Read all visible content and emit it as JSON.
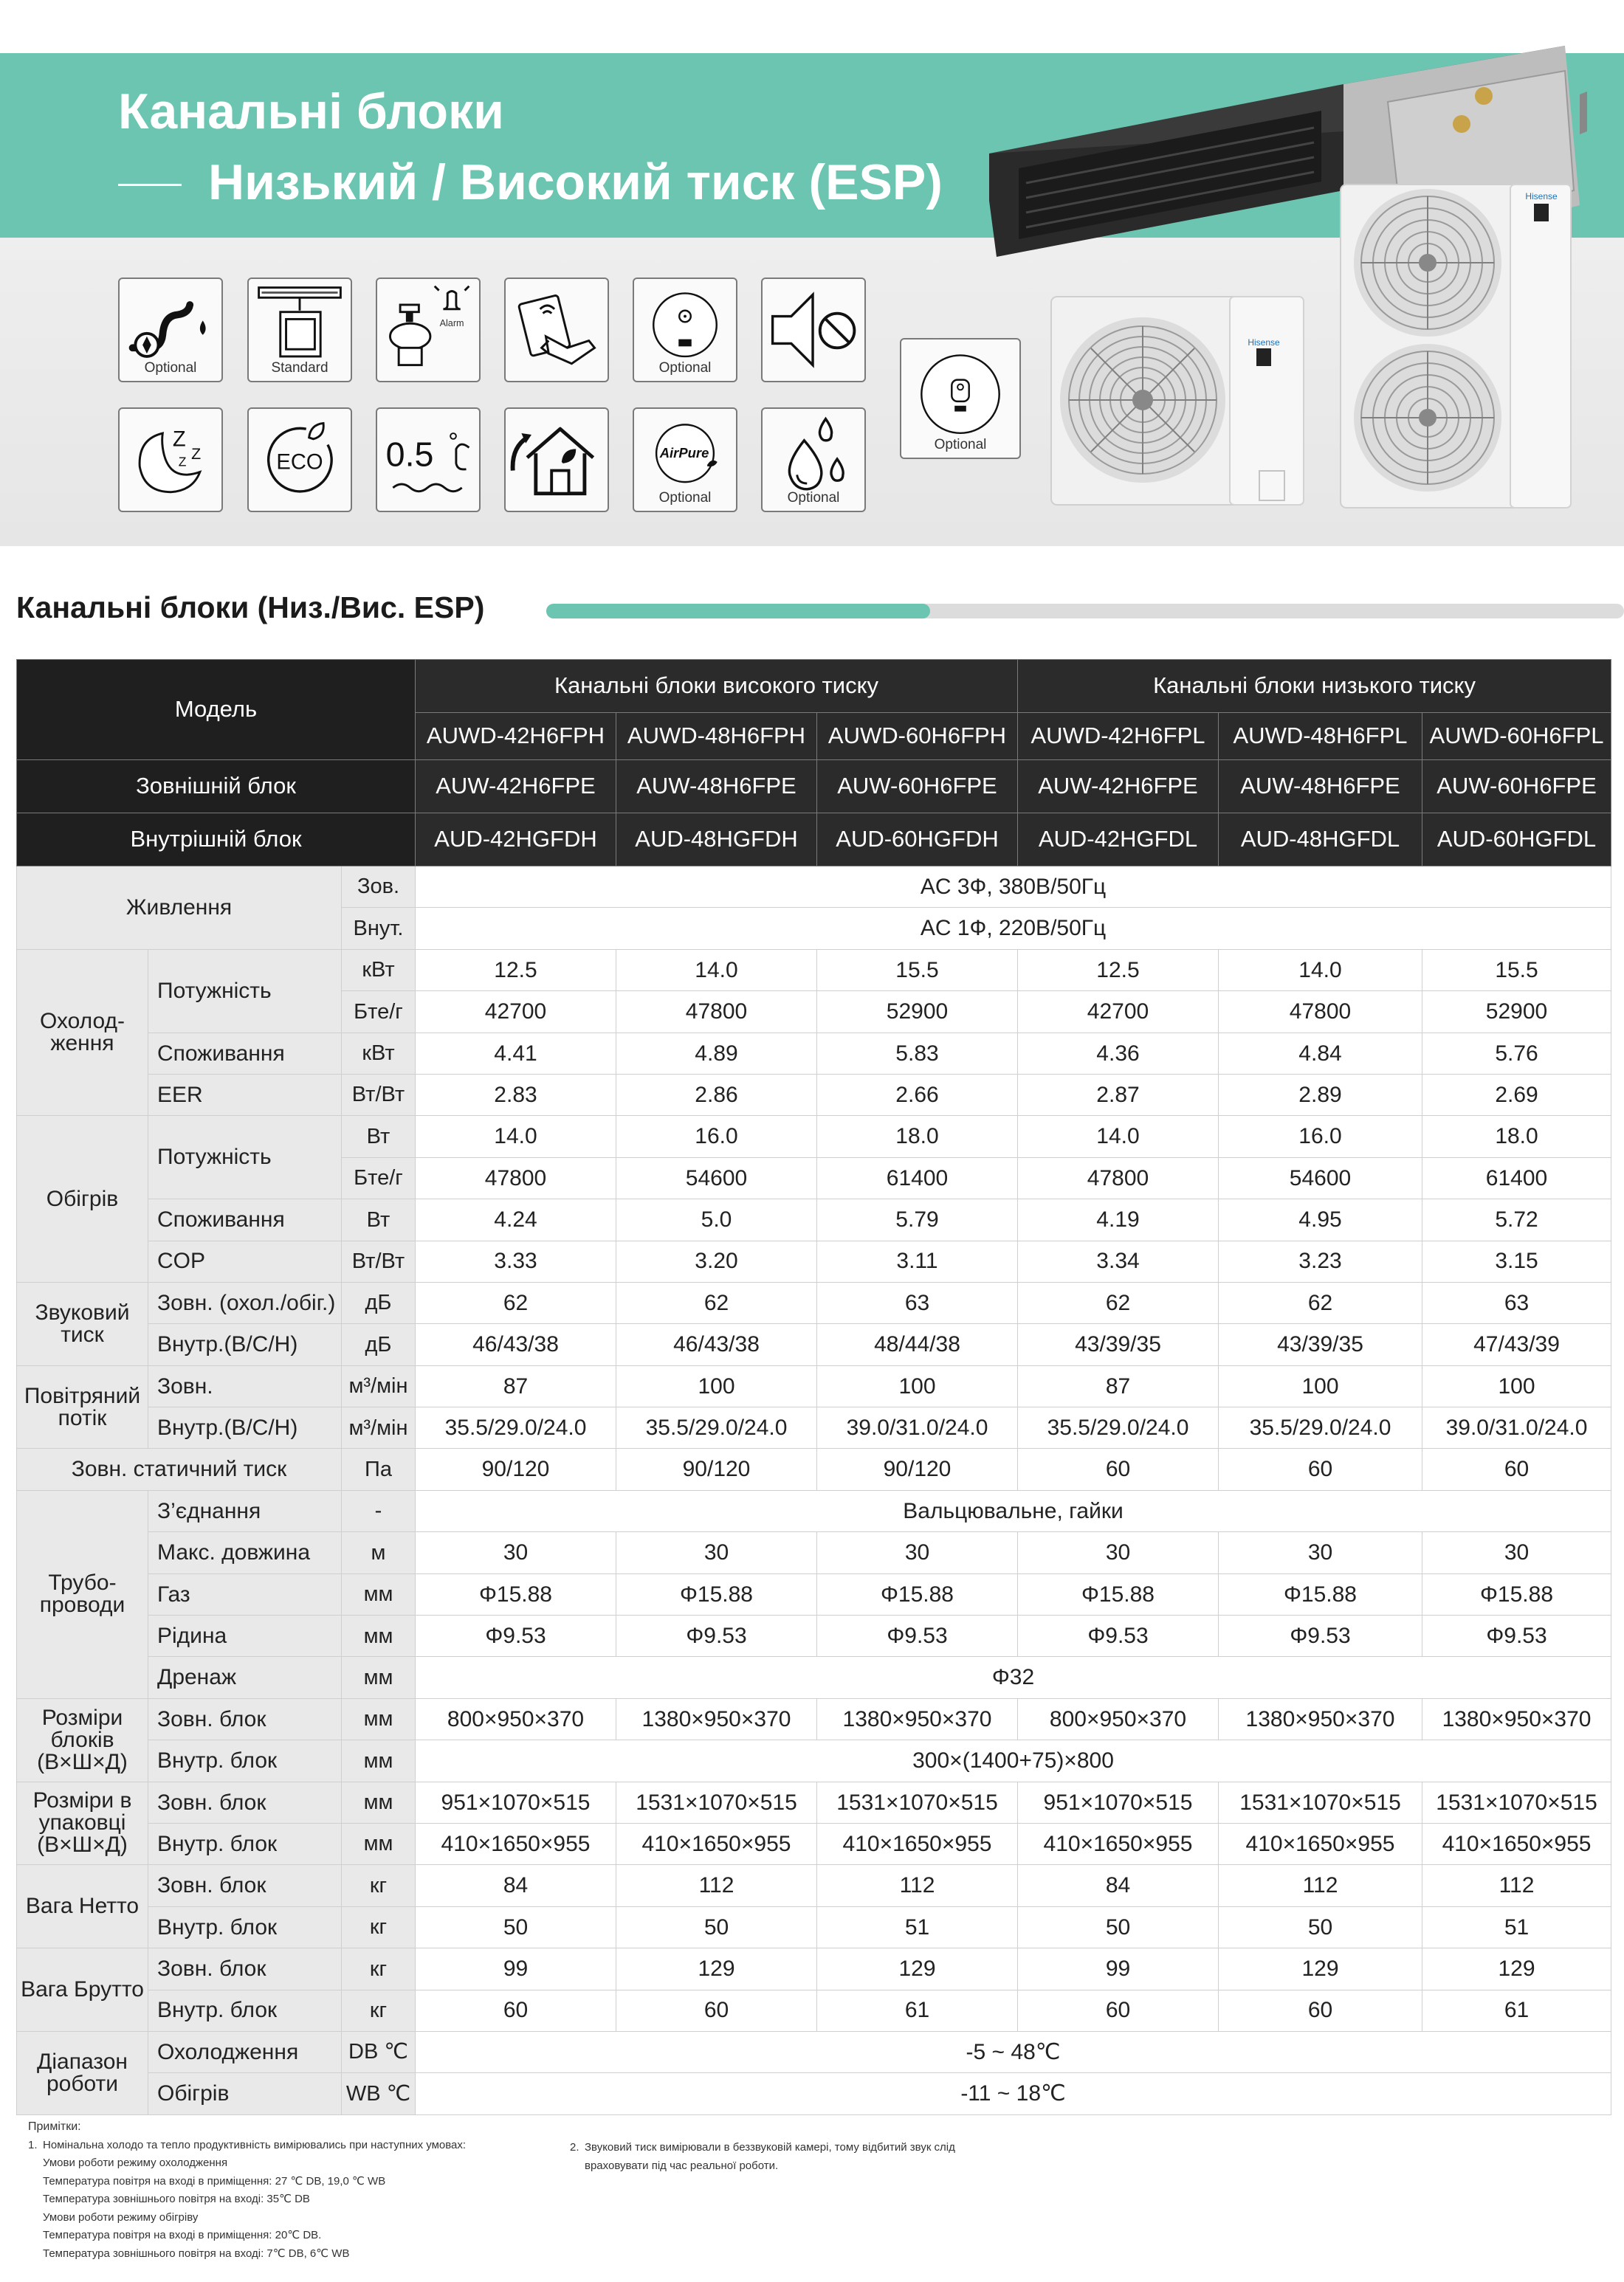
{
  "header": {
    "title_line1": "Канальні блоки",
    "title_line2": "Низький / Високий тиск (ESP)"
  },
  "features": [
    {
      "icon": "pump-drain-icon",
      "caption": "Optional"
    },
    {
      "icon": "wired-controller-icon",
      "caption": "Standard"
    },
    {
      "icon": "alarm-icon",
      "caption": "",
      "label": "Alarm"
    },
    {
      "icon": "card-key-icon",
      "caption": ""
    },
    {
      "icon": "remote-controller-icon",
      "caption": "Optional"
    },
    {
      "icon": "mute-icon",
      "caption": ""
    },
    {
      "icon": "sleep-icon",
      "caption": ""
    },
    {
      "icon": "eco-icon",
      "caption": "",
      "label": "ECO"
    },
    {
      "icon": "half-degree-icon",
      "caption": "",
      "label": "0.5"
    },
    {
      "icon": "smart-home-icon",
      "caption": ""
    },
    {
      "icon": "airpure-icon",
      "caption": "Optional",
      "label": "AirPure"
    },
    {
      "icon": "dehumidify-icon",
      "caption": "Optional"
    },
    {
      "icon": "wall-controller-icon",
      "caption": "Optional"
    }
  ],
  "section": {
    "title": "Канальні блоки (Низ./Вис. ESP)"
  },
  "table": {
    "header": {
      "model_label": "Модель",
      "group_high": "Канальні блоки високого тиску",
      "group_low": "Канальні блоки низького тиску",
      "models": [
        "AUWD-42H6FPH",
        "AUWD-48H6FPH",
        "AUWD-60H6FPH",
        "AUWD-42H6FPL",
        "AUWD-48H6FPL",
        "AUWD-60H6FPL"
      ],
      "outdoor_label": "Зовнішній блок",
      "outdoor": [
        "AUW-42H6FPE",
        "AUW-48H6FPE",
        "AUW-60H6FPE",
        "AUW-42H6FPE",
        "AUW-48H6FPE",
        "AUW-60H6FPE"
      ],
      "indoor_label": "Внутрішній блок",
      "indoor": [
        "AUD-42HGFDH",
        "AUD-48HGFDH",
        "AUD-60HGFDH",
        "AUD-42HGFDL",
        "AUD-48HGFDL",
        "AUD-60HGFDL"
      ]
    },
    "groups": {
      "power": "Живлення",
      "cooling": "Охолод- ження",
      "heating": "Обігрів",
      "sound": "Звуковий тиск",
      "airflow": "Повітряний потік",
      "esp": "Зовн. статичний тиск",
      "piping": "Трубо- проводи",
      "dims": "Розміри блоків (В×Ш×Д)",
      "pack": "Розміри в упаковці (В×Ш×Д)",
      "net": "Вага Нетто",
      "gross": "Вага Брутто",
      "range": "Діапазон роботи"
    },
    "rows": [
      {
        "sub": "",
        "unit": "Зов.",
        "span": "AC 3Ф, 380В/50Гц"
      },
      {
        "sub": "",
        "unit": "Внут.",
        "span": "AC 1Ф, 220В/50Гц"
      },
      {
        "sub": "Потужність",
        "unit": "кВт",
        "values": [
          "12.5",
          "14.0",
          "15.5",
          "12.5",
          "14.0",
          "15.5"
        ]
      },
      {
        "sub": "",
        "unit": "Бте/г",
        "values": [
          "42700",
          "47800",
          "52900",
          "42700",
          "47800",
          "52900"
        ]
      },
      {
        "sub": "Споживання",
        "unit": "кВт",
        "values": [
          "4.41",
          "4.89",
          "5.83",
          "4.36",
          "4.84",
          "5.76"
        ]
      },
      {
        "sub": "EER",
        "unit": "Вт/Вт",
        "values": [
          "2.83",
          "2.86",
          "2.66",
          "2.87",
          "2.89",
          "2.69"
        ]
      },
      {
        "sub": "Потужність",
        "unit": "Вт",
        "values": [
          "14.0",
          "16.0",
          "18.0",
          "14.0",
          "16.0",
          "18.0"
        ]
      },
      {
        "sub": "",
        "unit": "Бте/г",
        "values": [
          "47800",
          "54600",
          "61400",
          "47800",
          "54600",
          "61400"
        ]
      },
      {
        "sub": "Споживання",
        "unit": "Вт",
        "values": [
          "4.24",
          "5.0",
          "5.79",
          "4.19",
          "4.95",
          "5.72"
        ]
      },
      {
        "sub": "COP",
        "unit": "Вт/Вт",
        "values": [
          "3.33",
          "3.20",
          "3.11",
          "3.34",
          "3.23",
          "3.15"
        ]
      },
      {
        "sub": "Зовн. (охол./обіг.)",
        "unit": "дБ",
        "values": [
          "62",
          "62",
          "63",
          "62",
          "62",
          "63"
        ]
      },
      {
        "sub": "Внутр.(В/С/Н)",
        "unit": "дБ",
        "values": [
          "46/43/38",
          "46/43/38",
          "48/44/38",
          "43/39/35",
          "43/39/35",
          "47/43/39"
        ]
      },
      {
        "sub": "Зовн.",
        "unit": "м³/мін",
        "values": [
          "87",
          "100",
          "100",
          "87",
          "100",
          "100"
        ]
      },
      {
        "sub": "Внутр.(В/С/Н)",
        "unit": "м³/мін",
        "values": [
          "35.5/29.0/24.0",
          "35.5/29.0/24.0",
          "39.0/31.0/24.0",
          "35.5/29.0/24.0",
          "35.5/29.0/24.0",
          "39.0/31.0/24.0"
        ]
      },
      {
        "sub": "",
        "unit": "Па",
        "values": [
          "90/120",
          "90/120",
          "90/120",
          "60",
          "60",
          "60"
        ]
      },
      {
        "sub": "З’єднання",
        "unit": "-",
        "span": "Вальцювальне, гайки"
      },
      {
        "sub": "Макс. довжина",
        "unit": "м",
        "values": [
          "30",
          "30",
          "30",
          "30",
          "30",
          "30"
        ]
      },
      {
        "sub": "Газ",
        "unit": "мм",
        "values": [
          "Φ15.88",
          "Φ15.88",
          "Φ15.88",
          "Φ15.88",
          "Φ15.88",
          "Φ15.88"
        ]
      },
      {
        "sub": "Рідина",
        "unit": "мм",
        "values": [
          "Φ9.53",
          "Φ9.53",
          "Φ9.53",
          "Φ9.53",
          "Φ9.53",
          "Φ9.53"
        ]
      },
      {
        "sub": "Дренаж",
        "unit": "мм",
        "span": "Φ32"
      },
      {
        "sub": "Зовн. блок",
        "unit": "мм",
        "values": [
          "800×950×370",
          "1380×950×370",
          "1380×950×370",
          "800×950×370",
          "1380×950×370",
          "1380×950×370"
        ]
      },
      {
        "sub": "Внутр. блок",
        "unit": "мм",
        "span": "300×(1400+75)×800"
      },
      {
        "sub": "Зовн. блок",
        "unit": "мм",
        "values": [
          "951×1070×515",
          "1531×1070×515",
          "1531×1070×515",
          "951×1070×515",
          "1531×1070×515",
          "1531×1070×515"
        ]
      },
      {
        "sub": "Внутр. блок",
        "unit": "мм",
        "values": [
          "410×1650×955",
          "410×1650×955",
          "410×1650×955",
          "410×1650×955",
          "410×1650×955",
          "410×1650×955"
        ]
      },
      {
        "sub": "Зовн. блок",
        "unit": "кг",
        "values": [
          "84",
          "112",
          "112",
          "84",
          "112",
          "112"
        ]
      },
      {
        "sub": "Внутр. блок",
        "unit": "кг",
        "values": [
          "50",
          "50",
          "51",
          "50",
          "50",
          "51"
        ]
      },
      {
        "sub": "Зовн. блок",
        "unit": "кг",
        "values": [
          "99",
          "129",
          "129",
          "99",
          "129",
          "129"
        ]
      },
      {
        "sub": "Внутр. блок",
        "unit": "кг",
        "values": [
          "60",
          "60",
          "61",
          "60",
          "60",
          "61"
        ]
      },
      {
        "sub": "Охолодження",
        "unit": "DB ℃",
        "span": "-5 ~ 48℃"
      },
      {
        "sub": "Обігрів",
        "unit": "WB ℃",
        "span": "-11 ~ 18℃"
      }
    ]
  },
  "notes": {
    "title": "Примітки:",
    "n1": "Номінальна холодо та тепло продуктивність вимірювались при наступних умовах:",
    "n1_lines": [
      "Умови роботи режиму охолодження",
      "Температура повітря на вході в приміщення: 27 ℃ DB, 19,0 ℃ WB",
      "Температура зовнішнього повітря на вході: 35℃ DB",
      "Умови роботи режиму обігріву",
      "Температура повітря на вході в приміщення: 20℃ DB.",
      "Температура зовнішнього повітря на вході: 7℃ DB, 6℃ WB"
    ],
    "n2": "Звуковий тиск вимірювали в беззвуковій камері, тому відбитий звук слід",
    "n2_line2": "враховувати під час реальної роботи."
  },
  "brand": {
    "name": "Hisense"
  },
  "colors": {
    "accent": "#6cc5b0",
    "header_dark": "#2b2b2b",
    "label_bg": "#e9e9e9"
  }
}
